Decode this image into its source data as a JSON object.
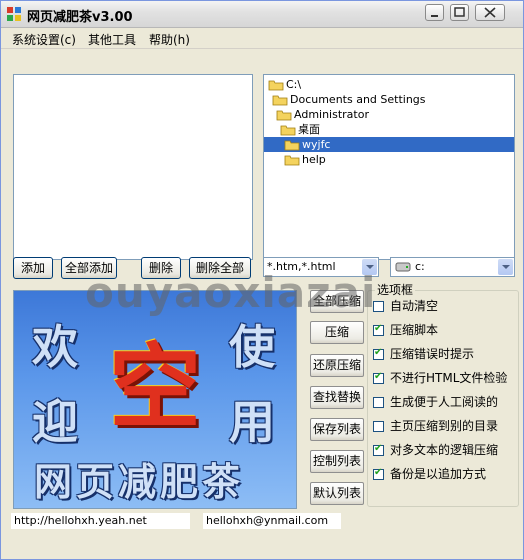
{
  "window": {
    "title": "网页减肥茶v3.00"
  },
  "menu": [
    {
      "label": "系统设置(c)"
    },
    {
      "label": "其他工具"
    },
    {
      "label": "帮助(h)"
    }
  ],
  "tree": [
    {
      "label": "C:\\",
      "indent": 0
    },
    {
      "label": "Documents and Settings",
      "indent": 1
    },
    {
      "label": "Administrator",
      "indent": 2
    },
    {
      "label": "桌面",
      "indent": 3
    },
    {
      "label": "wyjfc",
      "indent": 4,
      "selected": true
    },
    {
      "label": "help",
      "indent": 4
    }
  ],
  "file_buttons": {
    "add": "添加",
    "add_all": "全部添加",
    "delete": "删除",
    "delete_all": "删除全部"
  },
  "filter_combo": {
    "value": "*.htm,*.html"
  },
  "drive_combo": {
    "value": "c:"
  },
  "splash": {
    "chars": [
      "欢",
      "迎",
      "空",
      "使",
      "用"
    ],
    "banner": "网页减肥茶"
  },
  "action_buttons": [
    "全部压缩",
    "压缩",
    "还原压缩",
    "查找替换",
    "保存列表",
    "控制列表",
    "默认列表"
  ],
  "options": {
    "title": "选项框",
    "items": [
      {
        "label": "自动清空",
        "checked": false
      },
      {
        "label": "压缩脚本",
        "checked": true
      },
      {
        "label": "压缩错误时提示",
        "checked": true
      },
      {
        "label": "不进行HTML文件检验",
        "checked": true
      },
      {
        "label": "生成便于人工阅读的",
        "checked": false
      },
      {
        "label": "主页压缩到别的目录",
        "checked": false
      },
      {
        "label": "对多文本的逻辑压缩",
        "checked": true
      },
      {
        "label": "备份是以追加方式",
        "checked": true
      }
    ]
  },
  "status": {
    "url": "http://hellohxh.yeah.net",
    "email": "hellohxh@ynmail.com"
  },
  "watermark": "ouyaoxiazai"
}
